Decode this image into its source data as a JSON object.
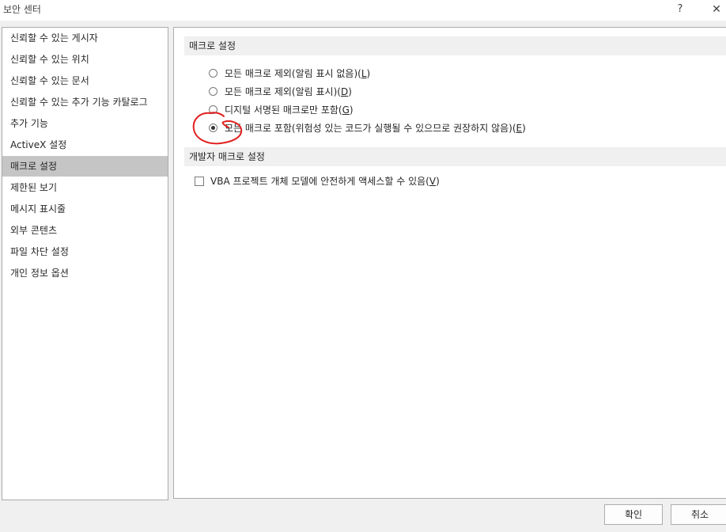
{
  "window": {
    "title": "보안 센터",
    "help_label": "?",
    "close_label": "✕"
  },
  "sidebar": {
    "items": [
      {
        "label": "신뢰할 수 있는 게시자",
        "selected": false
      },
      {
        "label": "신뢰할 수 있는 위치",
        "selected": false
      },
      {
        "label": "신뢰할 수 있는 문서",
        "selected": false
      },
      {
        "label": "신뢰할 수 있는 추가 기능 카탈로그",
        "selected": false
      },
      {
        "label": "추가 기능",
        "selected": false
      },
      {
        "label": "ActiveX 설정",
        "selected": false
      },
      {
        "label": "매크로 설정",
        "selected": true
      },
      {
        "label": "제한된 보기",
        "selected": false
      },
      {
        "label": "메시지 표시줄",
        "selected": false
      },
      {
        "label": "외부 콘텐츠",
        "selected": false
      },
      {
        "label": "파일 차단 설정",
        "selected": false
      },
      {
        "label": "개인 정보 옵션",
        "selected": false
      }
    ]
  },
  "macro_settings": {
    "header": "매크로 설정",
    "options": [
      {
        "text": "모든 매크로 제외(알림 표시 없음)(",
        "key": "L",
        "suffix": ")",
        "selected": false
      },
      {
        "text": "모든 매크로 제외(알림 표시)(",
        "key": "D",
        "suffix": ")",
        "selected": false
      },
      {
        "text": "디지털 서명된 매크로만 포함(",
        "key": "G",
        "suffix": ")",
        "selected": false
      },
      {
        "text": "모든 매크로 포함(위험성 있는 코드가 실행될 수 있으므로 권장하지 않음)(",
        "key": "E",
        "suffix": ")",
        "selected": true
      }
    ]
  },
  "developer_settings": {
    "header": "개발자 매크로 설정",
    "vba_text": "VBA 프로젝트 개체 모델에 안전하게 액세스할 수 있음(",
    "vba_key": "V",
    "vba_suffix": ")",
    "vba_checked": false
  },
  "footer": {
    "ok_label": "확인",
    "cancel_label": "취소"
  },
  "colors": {
    "annotation": "#e0201f",
    "selected_nav": "#c5c5c5"
  }
}
